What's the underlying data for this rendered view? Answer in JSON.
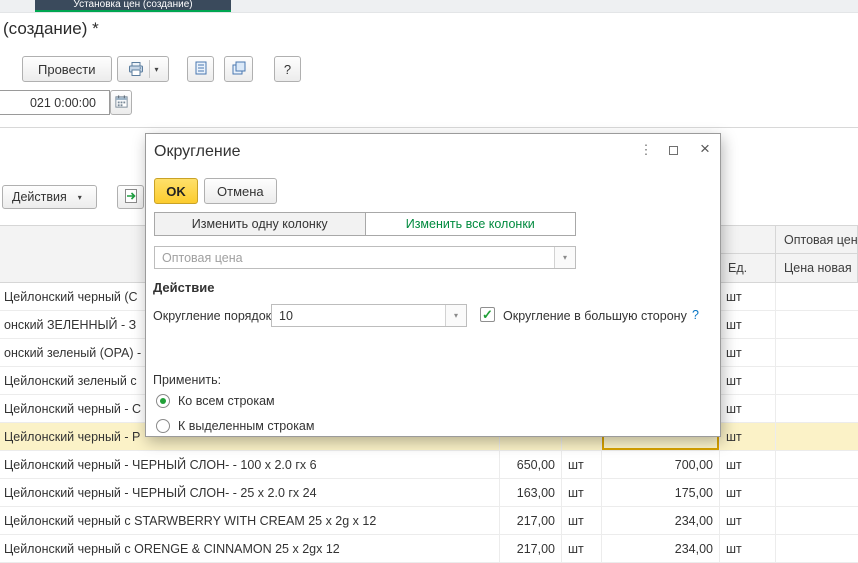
{
  "tabbar": {
    "active_tab": "Установка цен (создание)"
  },
  "header": {
    "title": "(создание) *"
  },
  "toolbar": {
    "post": "Провести",
    "help": "?"
  },
  "date_field": {
    "value": "021  0:00:00"
  },
  "list_toolbar": {
    "actions": "Действия",
    "actions_arrow": "▾"
  },
  "table": {
    "group_headers": {
      "wholesale": "Оптовая цен"
    },
    "columns": {
      "unit": "Ед.",
      "new_price": "Цена новая"
    },
    "rows": [
      {
        "name": "Цейлонский черный (С",
        "price": "",
        "unit1": "",
        "new_price": "",
        "unit2": "шт"
      },
      {
        "name": "онский ЗЕЛЕННЫЙ - З",
        "price": "",
        "unit1": "",
        "new_price": "",
        "unit2": "шт"
      },
      {
        "name": "онский зеленый (OPA) -",
        "price": "",
        "unit1": "",
        "new_price": "",
        "unit2": "шт"
      },
      {
        "name": "Цейлонский зеленый с",
        "price": "",
        "unit1": "",
        "new_price": "",
        "unit2": "шт"
      },
      {
        "name": "Цейлонский черный - С",
        "price": "",
        "unit1": "",
        "new_price": "",
        "unit2": "шт"
      },
      {
        "name": "Цейлонский черный - Р",
        "price": "",
        "unit1": "",
        "new_price": "",
        "unit2": "шт",
        "highlighted": true
      },
      {
        "name": "Цейлонский черный - ЧЕРНЫЙ  СЛОН- - 100 x 2.0 гх 6",
        "price": "650,00",
        "unit1": "шт",
        "new_price": "700,00",
        "unit2": "шт"
      },
      {
        "name": "Цейлонский черный - ЧЕРНЫЙ  СЛОН- - 25 x 2.0 гх 24",
        "price": "163,00",
        "unit1": "шт",
        "new_price": "175,00",
        "unit2": "шт"
      },
      {
        "name": "Цейлонский черный с  STARWBERRY WITH CREAM 25 x 2g x 12",
        "price": "217,00",
        "unit1": "шт",
        "new_price": "234,00",
        "unit2": "шт"
      },
      {
        "name": "Цейлонский черный с ORENGE & CINNAMON  25 x 2gx 12",
        "price": "217,00",
        "unit1": "шт",
        "new_price": "234,00",
        "unit2": "шт"
      }
    ]
  },
  "dialog": {
    "title": "Округление",
    "ok": "OK",
    "cancel": "Отмена",
    "tab_one_column": "Изменить одну колонку",
    "tab_all_columns": "Изменить все колонки",
    "column_placeholder": "Оптовая цена",
    "action_section": "Действие",
    "order_label": "Округление порядок:",
    "order_value": "10",
    "checkbox_check": "✓",
    "round_up_label": "Округление в большую сторону",
    "help": "?",
    "apply_label": "Применить:",
    "radio_all_rows": "Ко всем строкам",
    "radio_selected_rows": "К выделенным строкам",
    "kebab": "⋮",
    "close": "×"
  },
  "colors": {
    "accent_green": "#008a3e",
    "ok_yellow": "#fccc2e",
    "tab_underline": "#00a651",
    "highlight_row": "#fbf2c7",
    "selected_cell_border": "#d7a200"
  }
}
